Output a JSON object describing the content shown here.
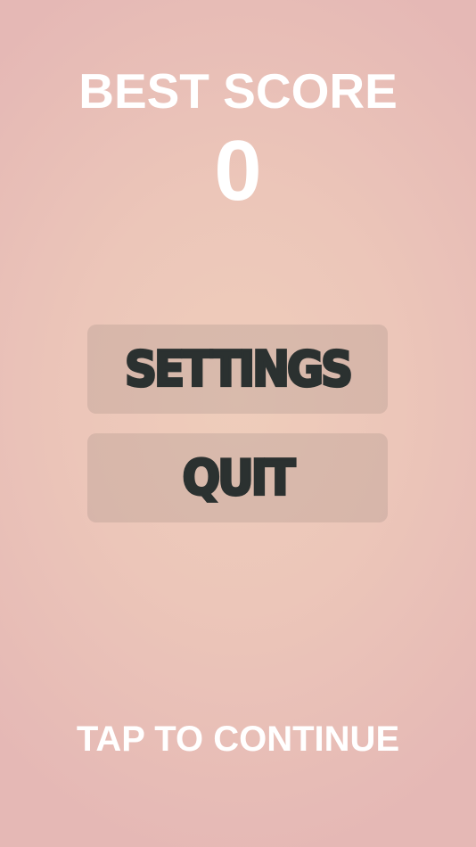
{
  "best_score": {
    "title": "BEST SCORE",
    "value": "0"
  },
  "menu": {
    "settings_label": "SETTINGS",
    "quit_label": "QUIT"
  },
  "footer": {
    "tap_to_continue": "TAP TO CONTINUE"
  },
  "colors": {
    "background_center": "#efcdbb",
    "background_edge": "#e5b8b5",
    "button_text": "#2b3130",
    "header_text": "#ffffff"
  }
}
